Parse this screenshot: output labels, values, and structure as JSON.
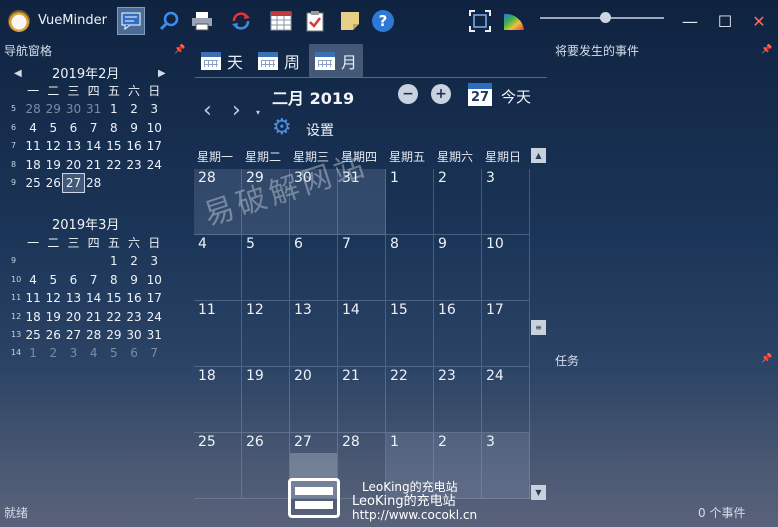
{
  "app": {
    "title": "VueMinder"
  },
  "toolbar": {
    "icons": [
      "chat-icon",
      "search-icon",
      "print-icon",
      "sync-icon",
      "table-icon",
      "clipboard-icon",
      "note-icon",
      "help-icon",
      "fullscreen-icon",
      "color-icon"
    ],
    "help_label": "?"
  },
  "nav_pane": {
    "title": "导航窗格",
    "months": [
      {
        "label": "2019年2月",
        "dow": [
          "一",
          "二",
          "三",
          "四",
          "五",
          "六",
          "日"
        ],
        "weeks": [
          {
            "wk": "5",
            "days": [
              "28",
              "29",
              "30",
              "31",
              "1",
              "2",
              "3"
            ],
            "dim": [
              0,
              1,
              2,
              3
            ]
          },
          {
            "wk": "6",
            "days": [
              "4",
              "5",
              "6",
              "7",
              "8",
              "9",
              "10"
            ],
            "dim": []
          },
          {
            "wk": "7",
            "days": [
              "11",
              "12",
              "13",
              "14",
              "15",
              "16",
              "17"
            ],
            "dim": []
          },
          {
            "wk": "8",
            "days": [
              "18",
              "19",
              "20",
              "21",
              "22",
              "23",
              "24"
            ],
            "dim": []
          },
          {
            "wk": "9",
            "days": [
              "25",
              "26",
              "27",
              "28"
            ],
            "dim": [],
            "today": 2
          }
        ]
      },
      {
        "label": "2019年3月",
        "dow": [
          "一",
          "二",
          "三",
          "四",
          "五",
          "六",
          "日"
        ],
        "weeks": [
          {
            "wk": "9",
            "days": [
              "",
              "",
              "",
              "",
              "1",
              "2",
              "3"
            ],
            "dim": []
          },
          {
            "wk": "10",
            "days": [
              "4",
              "5",
              "6",
              "7",
              "8",
              "9",
              "10"
            ],
            "dim": []
          },
          {
            "wk": "11",
            "days": [
              "11",
              "12",
              "13",
              "14",
              "15",
              "16",
              "17"
            ],
            "dim": []
          },
          {
            "wk": "12",
            "days": [
              "18",
              "19",
              "20",
              "21",
              "22",
              "23",
              "24"
            ],
            "dim": []
          },
          {
            "wk": "13",
            "days": [
              "25",
              "26",
              "27",
              "28",
              "29",
              "30",
              "31"
            ],
            "dim": []
          },
          {
            "wk": "14",
            "days": [
              "1",
              "2",
              "3",
              "4",
              "5",
              "6",
              "7"
            ],
            "dim": [
              0,
              1,
              2,
              3,
              4,
              5,
              6
            ]
          }
        ]
      }
    ]
  },
  "view_tabs": [
    {
      "label": "天"
    },
    {
      "label": "周"
    },
    {
      "label": "月",
      "active": true
    }
  ],
  "calendar": {
    "month_title": "二月 2019",
    "today_icon": "27",
    "today_label": "今天",
    "settings_label": "设置",
    "dow": [
      "星期一",
      "星期二",
      "星期三",
      "星期四",
      "星期五",
      "星期六",
      "星期日"
    ],
    "weeks": [
      [
        "28",
        "29",
        "30",
        "31",
        "1",
        "2",
        "3"
      ],
      [
        "4",
        "5",
        "6",
        "7",
        "8",
        "9",
        "10"
      ],
      [
        "11",
        "12",
        "13",
        "14",
        "15",
        "16",
        "17"
      ],
      [
        "18",
        "19",
        "20",
        "21",
        "22",
        "23",
        "24"
      ],
      [
        "25",
        "26",
        "27",
        "28",
        "1",
        "2",
        "3"
      ]
    ],
    "other_month_cells": [
      [
        0,
        0
      ],
      [
        0,
        1
      ],
      [
        0,
        2
      ],
      [
        0,
        3
      ],
      [
        4,
        4
      ],
      [
        4,
        5
      ],
      [
        4,
        6
      ]
    ],
    "today_cell": [
      4,
      2
    ]
  },
  "upcoming": {
    "title": "将要发生的事件"
  },
  "tasks": {
    "title": "任务"
  },
  "status": {
    "left": "就绪",
    "right": "0 个事件"
  },
  "watermark": {
    "site": "易破解网站",
    "brand_1": "LeoKing的充电站",
    "brand_2": "LeoKing的充电站",
    "url": "http://www.cocokl.cn"
  }
}
